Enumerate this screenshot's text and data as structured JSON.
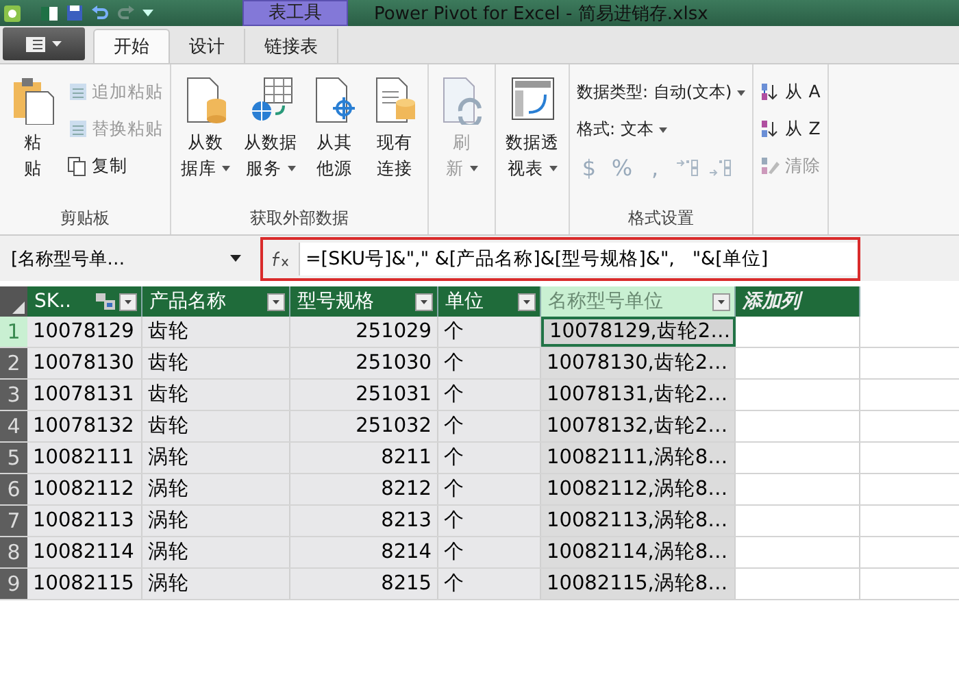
{
  "title_bar": {
    "context_tab": "表工具",
    "title": "Power Pivot for Excel - 简易进销存.xlsx"
  },
  "tabs": [
    {
      "label": "开始",
      "selected": true
    },
    {
      "label": "设计",
      "selected": false
    },
    {
      "label": "链接表",
      "selected": false
    }
  ],
  "ribbon": [
    {
      "label": "剪贴板",
      "items": [
        {
          "kind": "large",
          "lines": [
            "粘",
            "贴"
          ],
          "dropdown": false,
          "disabled": false
        },
        {
          "kind": "small",
          "label": "追加粘贴",
          "disabled": true
        },
        {
          "kind": "small",
          "label": "替换粘贴",
          "disabled": true
        },
        {
          "kind": "small",
          "label": "复制",
          "disabled": false
        }
      ]
    },
    {
      "label": "获取外部数据",
      "items": [
        {
          "kind": "large",
          "lines": [
            "从数",
            "据库"
          ],
          "dropdown": true,
          "disabled": false
        },
        {
          "kind": "large",
          "lines": [
            "从数据",
            "服务"
          ],
          "dropdown": true,
          "disabled": false
        },
        {
          "kind": "large",
          "lines": [
            "从其",
            "他源"
          ],
          "dropdown": false,
          "disabled": false
        },
        {
          "kind": "large",
          "lines": [
            "现有",
            "连接"
          ],
          "dropdown": false,
          "disabled": false
        }
      ]
    },
    {
      "items": [
        {
          "kind": "large",
          "lines": [
            "刷",
            "新"
          ],
          "dropdown": true,
          "disabled": true
        }
      ]
    },
    {
      "items": [
        {
          "kind": "large",
          "lines": [
            "数据透",
            "视表"
          ],
          "dropdown": true,
          "disabled": false
        }
      ]
    },
    {
      "label": "格式设置",
      "items": [
        {
          "kind": "menu",
          "label": "数据类型: 自动(文本)"
        },
        {
          "kind": "menu",
          "label": "格式: 文本"
        },
        {
          "kind": "number-formats",
          "symbols": [
            "$",
            "%",
            ","
          ],
          "disabled": true
        }
      ]
    },
    {
      "items": [
        {
          "kind": "small",
          "label": "从 A",
          "disabled": false
        },
        {
          "kind": "small",
          "label": "从 Z",
          "disabled": false
        },
        {
          "kind": "small",
          "label": "清除",
          "disabled": true
        }
      ]
    }
  ],
  "formula_bar": {
    "name_box": "[名称型号单…",
    "formula": "=[SKU号]&\",\" &[产品名称]&[型号规格]&\",   \"&[单位]",
    "highlighted": true
  },
  "table": {
    "columns": [
      {
        "label": "SK..",
        "kind": "data",
        "numeric": false,
        "related": true,
        "selected": false
      },
      {
        "label": "产品名称",
        "kind": "data",
        "numeric": false,
        "related": false,
        "selected": false
      },
      {
        "label": "型号规格",
        "kind": "data",
        "numeric": true,
        "related": false,
        "selected": false
      },
      {
        "label": "单位",
        "kind": "data",
        "numeric": false,
        "related": false,
        "selected": false
      },
      {
        "label": "名称型号单位",
        "kind": "data",
        "numeric": false,
        "related": false,
        "selected": true
      },
      {
        "label": "添加列",
        "kind": "add",
        "selected": false
      }
    ],
    "rows": [
      {
        "number": "1",
        "selected": true,
        "cells": [
          "10078129",
          "齿轮",
          "251029",
          "个",
          "10078129,齿轮2…"
        ]
      },
      {
        "number": "2",
        "selected": false,
        "cells": [
          "10078130",
          "齿轮",
          "251030",
          "个",
          "10078130,齿轮2…"
        ]
      },
      {
        "number": "3",
        "selected": false,
        "cells": [
          "10078131",
          "齿轮",
          "251031",
          "个",
          "10078131,齿轮2…"
        ]
      },
      {
        "number": "4",
        "selected": false,
        "cells": [
          "10078132",
          "齿轮",
          "251032",
          "个",
          "10078132,齿轮2…"
        ]
      },
      {
        "number": "5",
        "selected": false,
        "cells": [
          "10082111",
          "涡轮",
          "8211",
          "个",
          "10082111,涡轮8…"
        ]
      },
      {
        "number": "6",
        "selected": false,
        "cells": [
          "10082112",
          "涡轮",
          "8212",
          "个",
          "10082112,涡轮8…"
        ]
      },
      {
        "number": "7",
        "selected": false,
        "cells": [
          "10082113",
          "涡轮",
          "8213",
          "个",
          "10082113,涡轮8…"
        ]
      },
      {
        "number": "8",
        "selected": false,
        "cells": [
          "10082114",
          "涡轮",
          "8214",
          "个",
          "10082114,涡轮8…"
        ]
      },
      {
        "number": "9",
        "selected": false,
        "cells": [
          "10082115",
          "涡轮",
          "8215",
          "个",
          "10082115,涡轮8…"
        ]
      }
    ]
  }
}
